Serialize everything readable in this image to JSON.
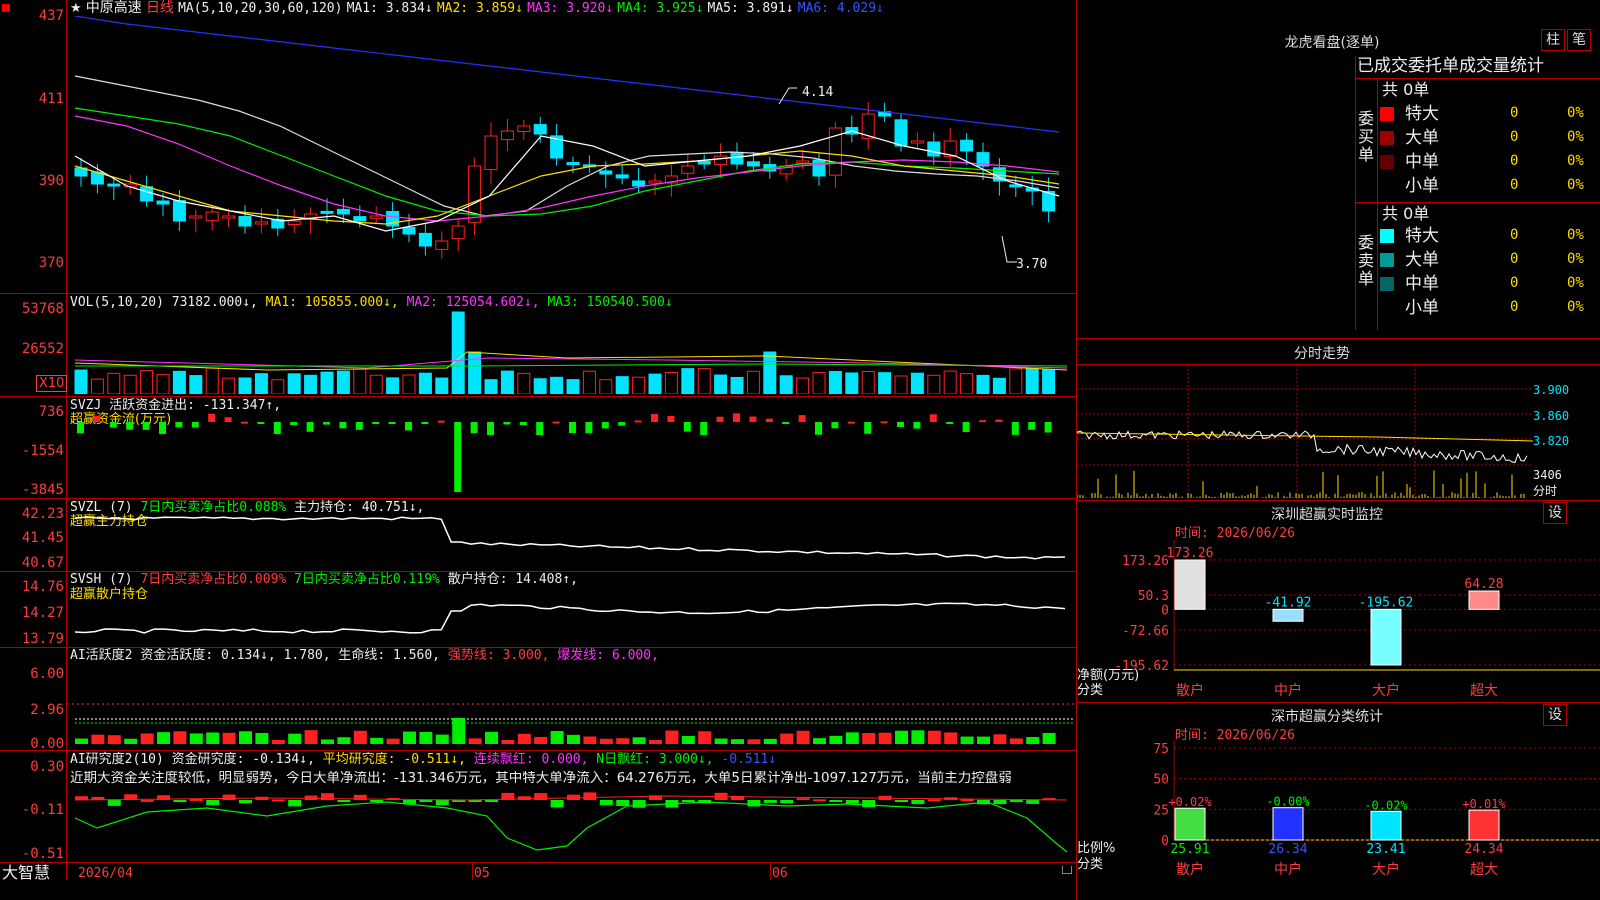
{
  "header": {
    "star": "★",
    "stock_name": "中原高速",
    "period": "日线",
    "ma_title": "MA(5,10,20,30,60,120)",
    "ma1": "MA1: 3.834↓",
    "ma2": "MA2: 3.859↓",
    "ma3": "MA3: 3.920↓",
    "ma4": "MA4: 3.925↓",
    "ma5": "MA5: 3.891↓",
    "ma6": "MA6: 4.029↓"
  },
  "price_axis": [
    "437",
    "411",
    "390",
    "370"
  ],
  "price_marks": {
    "high": "4.14",
    "low": "3.70"
  },
  "vol": {
    "title": "VOL(5,10,20)",
    "value": "73182.000↓,",
    "ma1": "MA1: 105855.000↓,",
    "ma2": "MA2: 125054.602↓,",
    "ma3": "MA3: 150540.500↓",
    "axis": [
      "53768",
      "26552"
    ],
    "unit": "X10"
  },
  "svzj": {
    "title": "SVZJ",
    "label": "活跃资金进出: -131.347↑,",
    "sub": "超赢资金流(万元)",
    "axis": [
      "736",
      "-1554",
      "-3845"
    ]
  },
  "svzl": {
    "title": "SVZL (7)",
    "label1": "7日内买卖净占比0.088%",
    "label2": "主力持仓: 40.751↓,",
    "sub": "超赢主力持仓",
    "axis": [
      "42.23",
      "41.45",
      "40.67"
    ]
  },
  "svsh": {
    "title": "SVSH (7)",
    "label1": "7日内买卖净占比0.009%",
    "label2": "7日内买卖净占比0.119%",
    "label3": "散户持仓: 14.408↑,",
    "sub": "超赢散户持仓",
    "axis": [
      "14.76",
      "14.27",
      "13.79"
    ]
  },
  "ai1": {
    "title": "AI活跃度2",
    "label1": "资金活跃度: 0.134↓,",
    "label2": "1.780,",
    "label3": "生命线: 1.560,",
    "label4": "强势线: 3.000,",
    "label5": "爆发线: 6.000,",
    "axis": [
      "6.00",
      "2.96",
      "0.00"
    ]
  },
  "ai2": {
    "title": "AI研究度2(10)",
    "label1": "资金研究度: -0.134↓,",
    "label2": "平均研究度: -0.511↓,",
    "label3": "连续飘红: 0.000,",
    "label4": "N日飘红: 3.000↓,",
    "label5": "-0.511↓",
    "comment": "近期大资金关注度较低，明显弱势，今日大单净流出：-131.346万元，其中特大单净流入：64.276万元，大单5日累计净出-1097.127万元，当前主力控盘弱",
    "axis": [
      "0.30",
      "-0.11",
      "-0.51"
    ]
  },
  "bottom": {
    "brand": "大智慧",
    "dates": [
      "2026/04",
      "05",
      "06"
    ]
  },
  "lhb": {
    "title": "龙虎看盘(逐单)",
    "btn1": "柱",
    "btn2": "笔",
    "tabs": "已成交委托单成交量统计",
    "buy_side": "委买单",
    "sell_side": "委卖单",
    "buy_total": "共 0单",
    "sell_total": "共 0单",
    "rows": [
      {
        "name": "特大",
        "count": "0",
        "pct": "0%"
      },
      {
        "name": "大单",
        "count": "0",
        "pct": "0%"
      },
      {
        "name": "中单",
        "count": "0",
        "pct": "0%"
      },
      {
        "name": "小单",
        "count": "0",
        "pct": "0%"
      }
    ],
    "buy_colors": [
      "#ff0000",
      "#990000",
      "#660000",
      "#000000"
    ],
    "sell_colors": [
      "#00ffff",
      "#009999",
      "#006666",
      "#000000"
    ]
  },
  "intraday": {
    "title": "分时走势",
    "axis": [
      "3.900",
      "3.860",
      "3.820"
    ],
    "vol_label": "3406",
    "vol_unit": "分时"
  },
  "sz_monitor": {
    "title": "深圳超赢实时监控",
    "btn": "设",
    "time": "时间: 2026/06/26",
    "axis": [
      "173.26",
      "50.3",
      "0",
      "-72.66",
      "-195.62"
    ],
    "ylabel": "净额(万元)",
    "xlabel": "分类",
    "categories": [
      "散户",
      "中户",
      "大户",
      "超大"
    ],
    "values": [
      "173.26",
      "-41.92",
      "-195.62",
      "64.28"
    ]
  },
  "sz_stat": {
    "title": "深市超赢分类统计",
    "btn": "设",
    "time": "时间: 2026/06/26",
    "axis": [
      "75",
      "50",
      "25",
      "0"
    ],
    "ylabel": "比例%",
    "xlabel": "分类",
    "categories": [
      "散户",
      "中户",
      "大户",
      "超大"
    ],
    "top_labels": [
      "+0.02%",
      "-0.00%",
      "-0.02%",
      "+0.01%"
    ],
    "values": [
      "25.91",
      "26.34",
      "23.41",
      "24.34"
    ]
  },
  "chart_data": [
    {
      "type": "bar",
      "title": "深圳超赢实时监控",
      "categories": [
        "散户",
        "中户",
        "大户",
        "超大"
      ],
      "values": [
        173.26,
        -41.92,
        -195.62,
        64.28
      ],
      "ylabel": "净额(万元)",
      "xlabel": "分类",
      "ylim": [
        -195.62,
        173.26
      ]
    },
    {
      "type": "bar",
      "title": "深市超赢分类统计",
      "categories": [
        "散户",
        "中户",
        "大户",
        "超大"
      ],
      "values": [
        25.91,
        26.34,
        23.41,
        24.34
      ],
      "ylabel": "比例%",
      "xlabel": "分类",
      "ylim": [
        0,
        75
      ]
    }
  ],
  "colors": {
    "up": "#ff2020",
    "down": "#00e5ff",
    "grid": "#b00000",
    "ma1": "#ffffff",
    "ma2": "#ffdd00",
    "ma3": "#ff33ff",
    "ma4": "#00ee00",
    "ma5": "#dddddd",
    "ma6": "#2233ff"
  }
}
